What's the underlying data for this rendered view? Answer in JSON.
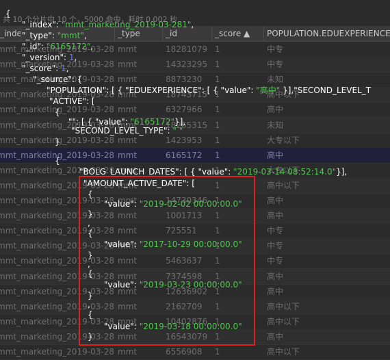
{
  "status_text": "共 10 个分片中 10 个，5000 命中，耗时 0.002 秒",
  "columns": [
    {
      "label": "_index"
    },
    {
      "label": ""
    },
    {
      "label": "_type"
    },
    {
      "label": "_id"
    },
    {
      "label": "_score ▲"
    },
    {
      "label": "POPULATION.EDUEXPERIENCE"
    }
  ],
  "rows": [
    {
      "index": "mmt_marketing_2019-03-281",
      "type": "mmt",
      "id": "18281079",
      "score": "1",
      "edu": "中专"
    },
    {
      "index": "mmt_marketing_2019-03-281",
      "type": "mmt",
      "id": "14323295",
      "score": "1",
      "edu": "中专"
    },
    {
      "index": "mmt_marketing_2019-03-281",
      "type": "mmt",
      "id": "8873230",
      "score": "1",
      "edu": "未知"
    },
    {
      "index": "mmt_marketing_2019-03-281",
      "type": "mmt",
      "id": "18743715",
      "score": "1",
      "edu": "高中以下"
    },
    {
      "index": "mmt_marketing_2019-03-281",
      "type": "mmt",
      "id": "6327966",
      "score": "1",
      "edu": "高中"
    },
    {
      "index": "mmt_marketing_2019-03-281",
      "type": "mmt",
      "id": "18265315",
      "score": "1",
      "edu": "未知"
    },
    {
      "index": "mmt_marketing_2019-03-281",
      "type": "mmt",
      "id": "1423953",
      "score": "1",
      "edu": "大专以下"
    },
    {
      "index": "mmt_marketing_2019-03-281",
      "type": "mmt",
      "id": "6165172",
      "score": "1",
      "edu": "高中"
    },
    {
      "index": "mmt_marketing_2019-03-281",
      "type": "mmt",
      "id": "",
      "score": "1",
      "edu": "大专以下"
    },
    {
      "index": "mmt_marketing_2019-03-281",
      "type": "mmt",
      "id": "",
      "score": "1",
      "edu": "高中以下"
    },
    {
      "index": "mmt_marketing_2019-03-281",
      "type": "mmt",
      "id": "14730346",
      "score": "1",
      "edu": "高中"
    },
    {
      "index": "mmt_marketing_2019-03-281",
      "type": "mmt",
      "id": "1001713",
      "score": "1",
      "edu": "高中"
    },
    {
      "index": "mmt_marketing_2019-03-281",
      "type": "mmt",
      "id": "725551",
      "score": "1",
      "edu": "中专"
    },
    {
      "index": "mmt_marketing_2019-03-281",
      "type": "mmt",
      "id": "",
      "score": "1",
      "edu": "中专"
    },
    {
      "index": "mmt_marketing_2019-03-281",
      "type": "mmt",
      "id": "5463637",
      "score": "1",
      "edu": "中专"
    },
    {
      "index": "mmt_marketing_2019-03-281",
      "type": "mmt",
      "id": "7374598",
      "score": "1",
      "edu": "高中"
    },
    {
      "index": "mmt_marketing_2019-03-281",
      "type": "mmt",
      "id": "12636902",
      "score": "1",
      "edu": "高中"
    },
    {
      "index": "mmt_marketing_2019-03-281",
      "type": "mmt",
      "id": "2162709",
      "score": "1",
      "edu": "高中以下"
    },
    {
      "index": "mmt_marketing_2019-03-281",
      "type": "mmt",
      "id": "10402876",
      "score": "1",
      "edu": "高中以下"
    },
    {
      "index": "mmt_marketing_2019-03-281",
      "type": "mmt",
      "id": "16543079",
      "score": "1",
      "edu": "高中"
    },
    {
      "index": "mmt_marketing_2019-03-281",
      "type": "mmt",
      "id": "6556908",
      "score": "1",
      "edu": "高中以下"
    }
  ],
  "selected_row": 7,
  "json_popup": {
    "open_brace": "{",
    "index_key": "\"_index\"",
    "index_val": "\"mmt_marketing_2019-03-281\"",
    "type_key": "\"_type\"",
    "type_val": "\"mmt\"",
    "id_key": "\"_id\"",
    "id_val": "\"6165172\"",
    "version_key": "\"_version\"",
    "version_val": "1",
    "score_key": "\"_score\"",
    "score_val": "1",
    "source_key": "\"_source\"",
    "population_key": "\"POPULATION\"",
    "population_inner": "[ { \"EDUEXPERIENCE\": [ { \"value\": ",
    "population_edu_val": "\"高中\"",
    "population_tail": " }],\"SECOND_LEVEL_T",
    "active_key": "\"ACTIVE\"",
    "active_inner_key": "\"\"",
    "active_inner_prefix": ": [ { \"value\": ",
    "active_inner_val": "\"6165172\"",
    "active_inner_suffix": "}],",
    "second_level_key": "\"SECOND_LEVEL_TYPE\"",
    "second_level_val": "\" \"",
    "bolg_key": "\"BOLG_LAUNCH_DATES\"",
    "bolg_prefix": ": [ { \"value\": ",
    "bolg_val": "\"2019-03-14 08:52:14.0\"",
    "bolg_suffix": "}],",
    "amount_key": "\"AMOUNT_ACTIVE_DATE\"",
    "value_key": "\"value\"",
    "amount_values": [
      "\"2019-02-02 00:00:00.0\"",
      "\"2017-10-29 00:00:00.0\"",
      "\"2019-03-23 00:00:00.0\"",
      "\"2019-03-18 00:00:00.0\""
    ]
  }
}
